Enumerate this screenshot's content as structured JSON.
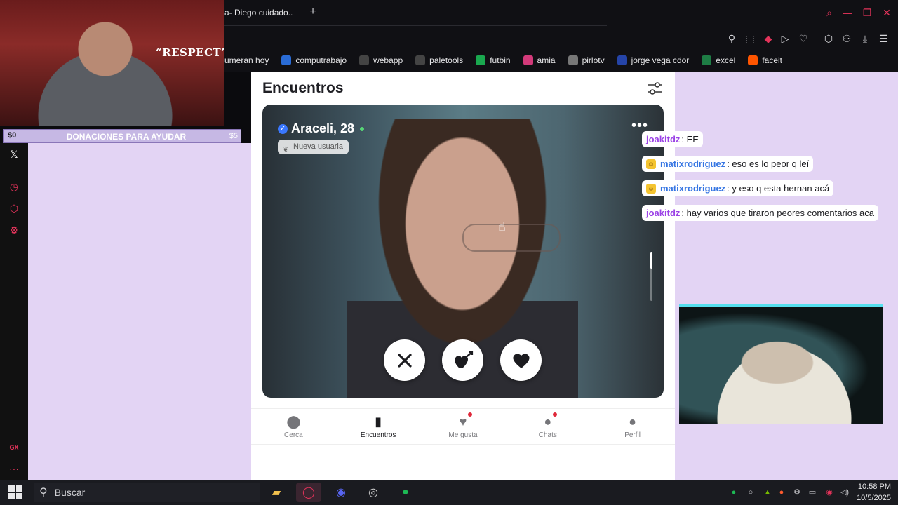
{
  "browser": {
    "tab_title": "a- Diego cuidado..",
    "new_tab": "+",
    "bookmarks": [
      {
        "label": "umeran hoy",
        "icon": "none",
        "color": "#101014"
      },
      {
        "label": "computrabajo",
        "icon": "computrabajo-icon",
        "color": "#2a6cd6"
      },
      {
        "label": "webapp",
        "icon": "document-icon",
        "color": "#444"
      },
      {
        "label": "paletools",
        "icon": "document-icon",
        "color": "#444"
      },
      {
        "label": "futbin",
        "icon": "futbin-icon",
        "color": "#1aa84f"
      },
      {
        "label": "amia",
        "icon": "amia-icon",
        "color": "#d33a7a"
      },
      {
        "label": "pirlotv",
        "icon": "pirlotv-icon",
        "color": "#777"
      },
      {
        "label": "jorge vega cdor",
        "icon": "chevron-icon",
        "color": "#2544a8"
      },
      {
        "label": "excel",
        "icon": "excel-icon",
        "color": "#1e7d45"
      },
      {
        "label": "faceit",
        "icon": "faceit-icon",
        "color": "#ff5500"
      }
    ]
  },
  "overlay": {
    "respect_text": "“RESPECT”",
    "donation_current": "$0",
    "donation_label": "DONACIONES PARA AYUDAR",
    "donation_goal": "$5",
    "x_logo": "𝕏"
  },
  "app": {
    "title": "Encuentros",
    "profile": {
      "name": "Araceli, 28",
      "badge": "Nueva usuaria"
    },
    "nav": [
      {
        "label": "Cerca",
        "icon": "location-pin-icon",
        "glyph": "⬤",
        "active": false,
        "dot": false
      },
      {
        "label": "Encuentros",
        "icon": "cards-icon",
        "glyph": "▮",
        "active": true,
        "dot": false
      },
      {
        "label": "Me gusta",
        "icon": "heart-icon",
        "glyph": "♥",
        "active": false,
        "dot": true
      },
      {
        "label": "Chats",
        "icon": "chat-bubble-icon",
        "glyph": "●",
        "active": false,
        "dot": true
      },
      {
        "label": "Perfil",
        "icon": "person-icon",
        "glyph": "●",
        "active": false,
        "dot": false
      }
    ]
  },
  "chat": [
    {
      "user": "joakitdz",
      "text": ": EE",
      "badge": false
    },
    {
      "user": "matixrodriguez",
      "text": ": eso es lo peor q leí",
      "badge": true
    },
    {
      "user": "matixrodriguez",
      "text": ": y eso q esta hernan acá",
      "badge": true
    },
    {
      "user": "joakitdz",
      "text": ": hay varios que tiraron peores comentarios aca",
      "badge": false
    }
  ],
  "taskbar": {
    "search_placeholder": "Buscar",
    "time": "10:58 PM",
    "date": "10/5/2025"
  },
  "left_icons": {
    "gx_label": "GX",
    "more_label": "···"
  }
}
